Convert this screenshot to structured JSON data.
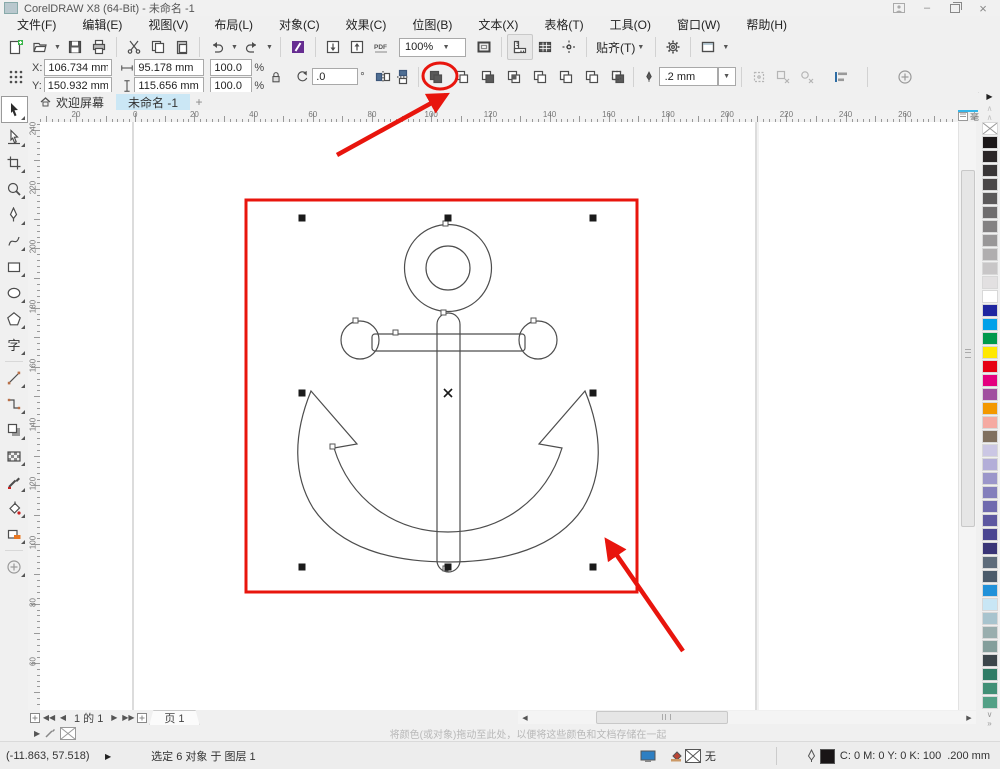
{
  "window": {
    "title": "CorelDRAW X8 (64-Bit) - 未命名 -1"
  },
  "menu": {
    "items": [
      "文件(F)",
      "编辑(E)",
      "视图(V)",
      "布局(L)",
      "对象(C)",
      "效果(C)",
      "位图(B)",
      "文本(X)",
      "表格(T)",
      "工具(O)",
      "窗口(W)",
      "帮助(H)"
    ]
  },
  "toolbar": {
    "zoom_level": "100%",
    "snap_label": "贴齐(T)",
    "pdf_label": "PDF",
    "icon_names": [
      "new-document",
      "open-folder",
      "save",
      "print",
      "cut",
      "copy",
      "paste",
      "undo",
      "redo",
      "search-content",
      "import",
      "export",
      "publish-pdf",
      "zoom-level-combo",
      "full-screen-preview",
      "show-rulers",
      "show-grid",
      "show-guidelines",
      "snap-menu",
      "options-gear",
      "launcher"
    ]
  },
  "property_bar": {
    "x_label": "X:",
    "y_label": "Y:",
    "x_value": "106.734 mm",
    "y_value": "150.932 mm",
    "width_value": "95.178 mm",
    "height_value": "115.656 mm",
    "scale_x": "100.0",
    "scale_y": "100.0",
    "percent": "%",
    "angle_value": ".0",
    "degree": "°",
    "outline_width": ".2 mm",
    "shaping_icons": [
      "combine",
      "weld",
      "trim",
      "intersect",
      "simplify",
      "front-minus-back",
      "back-minus-front",
      "boundary"
    ],
    "highlighted_icon": "weld"
  },
  "document_tabs": {
    "items": [
      {
        "label": "欢迎屏幕",
        "active": false
      },
      {
        "label": "未命名 -1",
        "active": true
      }
    ],
    "new_tab": "+"
  },
  "rulers": {
    "unit": "毫米",
    "h_labels": [
      "20",
      "0",
      "20",
      "40",
      "60",
      "80",
      "100",
      "120",
      "140",
      "160",
      "180",
      "200",
      "220",
      "240",
      "260"
    ],
    "v_labels": [
      "240",
      "220",
      "200",
      "180",
      "160",
      "140",
      "120",
      "100",
      "80",
      "60"
    ]
  },
  "toolbox": {
    "selected": "pick",
    "text_tool_glyph": "字",
    "tools": [
      "pick",
      "shape",
      "crop",
      "zoom",
      "pen",
      "bspline",
      "rectangle",
      "ellipse",
      "polygon",
      "text",
      "parallel-dimension",
      "connector",
      "drop-shadow",
      "transparency",
      "color-eyedropper",
      "interactive-fill",
      "smart-fill",
      "add-tools"
    ]
  },
  "palette": {
    "colors": [
      "none",
      "#1b1718",
      "#2a2627",
      "#393637",
      "#4a4748",
      "#5c5a5b",
      "#6f6d6e",
      "#838182",
      "#999798",
      "#b0aeaf",
      "#c8c6c7",
      "#e2e0e1",
      "#ffffff",
      "#1f26a0",
      "#00a0e9",
      "#00994c",
      "#ffe800",
      "#e60012",
      "#e4007f",
      "#a0509f",
      "#f39800",
      "#f5aaa2",
      "#80705f",
      "#cbc7e4",
      "#b3aed8",
      "#9b96ca",
      "#847fbc",
      "#6f6aae",
      "#5d58a0",
      "#4b4692",
      "#3a3577",
      "#5e6c7b",
      "#4a5a6a",
      "#2191d9",
      "#c8e6f5",
      "#a8c4ce",
      "#99aeae",
      "#849e9b",
      "#3c464b",
      "#2f7c66",
      "#418f76",
      "#53a086"
    ]
  },
  "page_bar": {
    "page_indicator": "1 的 1",
    "page_tab": "页 1"
  },
  "color_tray": {
    "hint": "将颜色(或对象)拖动至此处，以便将这些颜色和文档存储在一起"
  },
  "status_bar": {
    "cursor_position": "(-11.863, 57.518)",
    "selection_info": "选定 6 对象 于 图层 1",
    "fill_none_label": "无",
    "cmyk_label": "C: 0 M: 0 Y: 0 K: 100",
    "outline_value": ".200 mm"
  },
  "annotations": {
    "highlight_color": "#e8150d"
  }
}
